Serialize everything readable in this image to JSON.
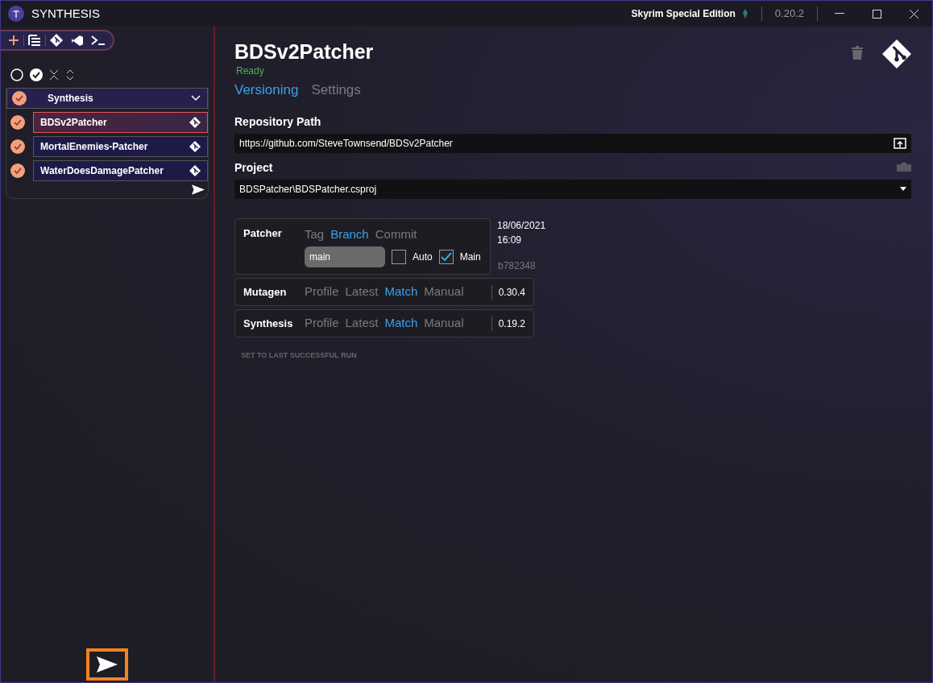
{
  "window": {
    "title": "SYNTHESIS",
    "game": "Skyrim Special Edition",
    "version": "0.20.2"
  },
  "sidebar": {
    "groups": [
      {
        "name": "Synthesis",
        "checked": true,
        "expanded": true,
        "patchers": [
          {
            "name": "BDSv2Patcher",
            "checked": true,
            "selected": true
          },
          {
            "name": "MortalEnemies-Patcher",
            "checked": true,
            "selected": false
          },
          {
            "name": "WaterDoesDamagePatcher",
            "checked": true,
            "selected": false
          }
        ]
      }
    ]
  },
  "main": {
    "title": "BDSv2Patcher",
    "status": "Ready",
    "tabs": [
      {
        "label": "Versioning",
        "selected": true
      },
      {
        "label": "Settings",
        "selected": false
      }
    ],
    "repository": {
      "label": "Repository Path",
      "value": "https://github.com/SteveTownsend/BDSv2Patcher"
    },
    "project": {
      "label": "Project",
      "value": "BDSPatcher\\BDSPatcher.csproj"
    },
    "patcher": {
      "label": "Patcher",
      "options": [
        {
          "label": "Tag",
          "selected": false
        },
        {
          "label": "Branch",
          "selected": true
        },
        {
          "label": "Commit",
          "selected": false
        }
      ],
      "branch": "main",
      "auto": {
        "label": "Auto",
        "checked": false
      },
      "main": {
        "label": "Main",
        "checked": true
      },
      "date": "18/06/2021",
      "time": "16:09",
      "commit": "b782348"
    },
    "versions": [
      {
        "label": "Mutagen",
        "options": [
          {
            "label": "Profile",
            "selected": false
          },
          {
            "label": "Latest",
            "selected": false
          },
          {
            "label": "Match",
            "selected": true
          },
          {
            "label": "Manual",
            "selected": false
          }
        ],
        "version": "0.30.4"
      },
      {
        "label": "Synthesis",
        "options": [
          {
            "label": "Profile",
            "selected": false
          },
          {
            "label": "Latest",
            "selected": false
          },
          {
            "label": "Match",
            "selected": true
          },
          {
            "label": "Manual",
            "selected": false
          }
        ],
        "version": "0.19.2"
      }
    ],
    "reset_button": "SET TO LAST SUCCESSFUL RUN"
  }
}
